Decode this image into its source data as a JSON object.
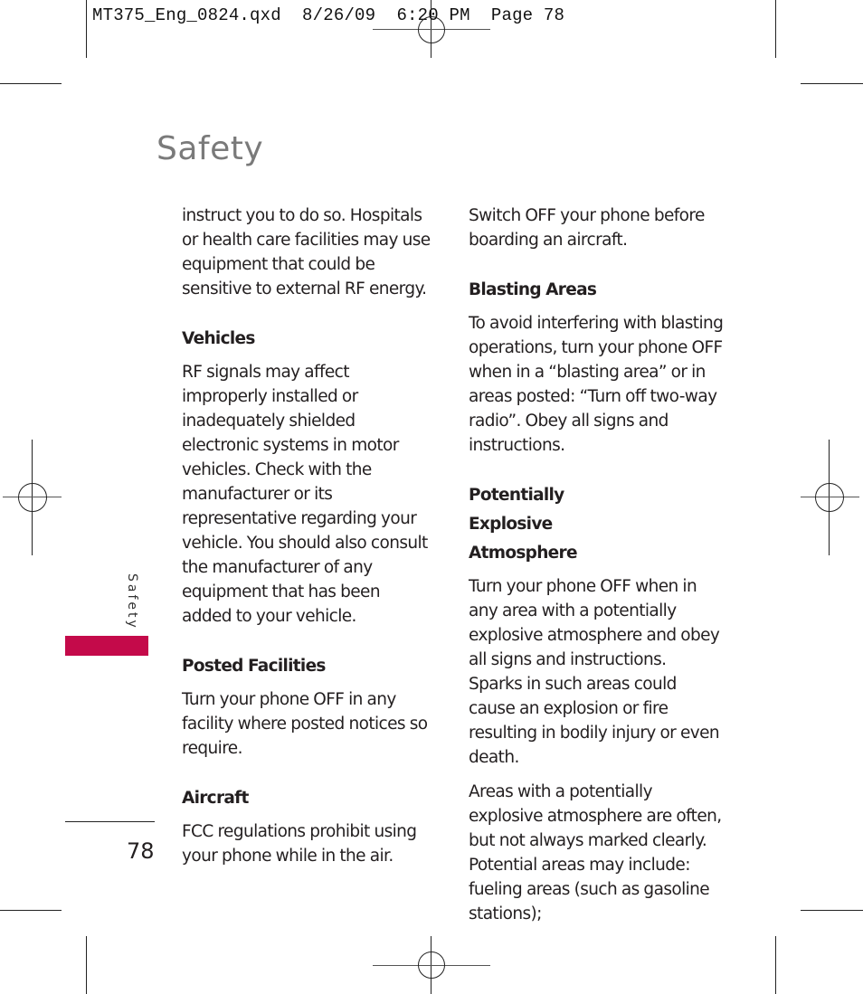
{
  "slug_line": "MT375_Eng_0824.qxd  8/26/09  6:20 PM  Page 78",
  "page_title": "Safety",
  "side_tab": {
    "label": "Safety",
    "color": "#c40a4a"
  },
  "page_number": "78",
  "left_column": {
    "intro": "instruct you to do so. Hospitals or health care facilities may use equipment that could be sensitive to external RF energy.",
    "sections": [
      {
        "heading": "Vehicles",
        "body": "RF signals may affect improperly installed or inadequately shielded electronic systems in motor vehicles. Check with the manufacturer or its representative regarding your vehicle. You should also consult the manufacturer of any equipment that has been added to your vehicle."
      },
      {
        "heading": "Posted Facilities",
        "body": "Turn your phone OFF in any facility where posted notices so require."
      },
      {
        "heading": "Aircraft",
        "body": "FCC regulations prohibit using your phone while in the air."
      }
    ]
  },
  "right_column": {
    "intro": "Switch OFF your phone before boarding an aircraft.",
    "sections": [
      {
        "heading": "Blasting Areas",
        "body": "To avoid interfering with blasting operations, turn your phone OFF when in a “blasting area” or in areas posted: “Turn off two-way radio”. Obey all signs and instructions."
      },
      {
        "heading": "Potentially Explosive Atmosphere",
        "body": "Turn your phone OFF when in any area with a potentially explosive atmosphere and obey all signs and instructions. Sparks in such areas could cause an explosion or fire resulting in bodily injury or even death.",
        "body2": "Areas with a potentially explosive atmosphere are often, but not always marked clearly. Potential areas may include: fueling areas (such as gasoline stations);"
      }
    ]
  }
}
